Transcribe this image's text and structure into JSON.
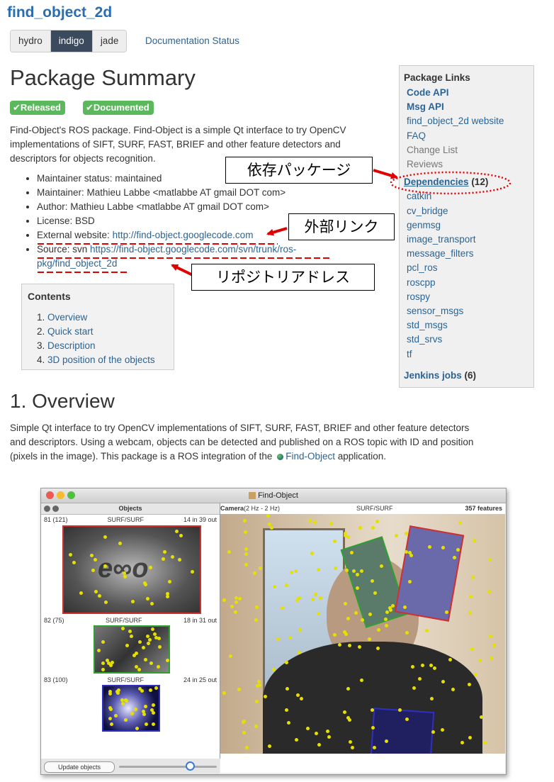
{
  "package": {
    "name": "find_object_2d",
    "distros": [
      "hydro",
      "indigo",
      "jade"
    ],
    "active_distro": "indigo",
    "doc_status": "Documentation Status"
  },
  "summary": {
    "title": "Package Summary",
    "badges": [
      "Released",
      "Documented"
    ],
    "description": [
      "Find-Object's ROS package. Find-Object is a simple Qt interface to try OpenCV",
      "implementations of SIFT, SURF, FAST, BRIEF and other feature detectors and",
      "descriptors for objects recognition."
    ],
    "meta": {
      "maintainer_status": "Maintainer status: maintained",
      "maintainer": "Maintainer: Mathieu Labbe <matlabbe AT gmail DOT com>",
      "author": "Author: Mathieu Labbe <matlabbe AT gmail DOT com>",
      "license": "License: BSD",
      "website_label": "External website: ",
      "website_url": "http://find-object.googlecode.com",
      "source_label": "Source: svn ",
      "source_url_1": "https://find-object.googlecode.com/svn/trunk/ros-",
      "source_url_2": "pkg/find_object_2d"
    }
  },
  "contents": {
    "title": "Contents",
    "items": [
      "Overview",
      "Quick start",
      "Description",
      "3D position of the objects"
    ]
  },
  "sidebar": {
    "title": "Package Links",
    "links": [
      "Code API",
      "Msg API",
      "find_object_2d website",
      "FAQ",
      "Change List",
      "Reviews"
    ],
    "dependencies_label": "Dependencies",
    "dependencies_count": "(12)",
    "dependencies": [
      "catkin",
      "cv_bridge",
      "genmsg",
      "image_transport",
      "message_filters",
      "pcl_ros",
      "roscpp",
      "rospy",
      "sensor_msgs",
      "std_msgs",
      "std_srvs",
      "tf"
    ],
    "jenkins_label": "Jenkins jobs",
    "jenkins_count": "(6)"
  },
  "overview": {
    "title": "1. Overview",
    "text_1": "Simple Qt interface to try OpenCV implementations of SIFT, SURF, FAST, BRIEF and other feature detectors",
    "text_2": "and descriptors. Using a webcam, objects can be detected and published on a ROS topic with ID and position",
    "text_3a": "(pixels in the image). This package is a ROS integration of the ",
    "text_3_link": "Find-Object",
    "text_3b": " application."
  },
  "annotations": {
    "dependencies": "依存パッケージ",
    "external_link": "外部リンク",
    "repository": "リポジトリアドレス",
    "color": "#e00000"
  },
  "app_window": {
    "title": "Find-Object",
    "objects_header": "Objects",
    "objects": [
      {
        "id": "81 (121)",
        "desc": "SURF/SURF",
        "inliers": "14 in 39 out",
        "border": "#d03030"
      },
      {
        "id": "82 (75)",
        "desc": "SURF/SURF",
        "inliers": "18 in 31 out",
        "border": "#30a030"
      },
      {
        "id": "83 (100)",
        "desc": "SURF/SURF",
        "inliers": "24 in 25 out",
        "border": "#3030c0"
      }
    ],
    "camera_label": "Camera",
    "camera_rate": "(2 Hz - 2 Hz)",
    "camera_desc": "SURF/SURF",
    "features": "357 features",
    "update_button": "Update objects"
  }
}
